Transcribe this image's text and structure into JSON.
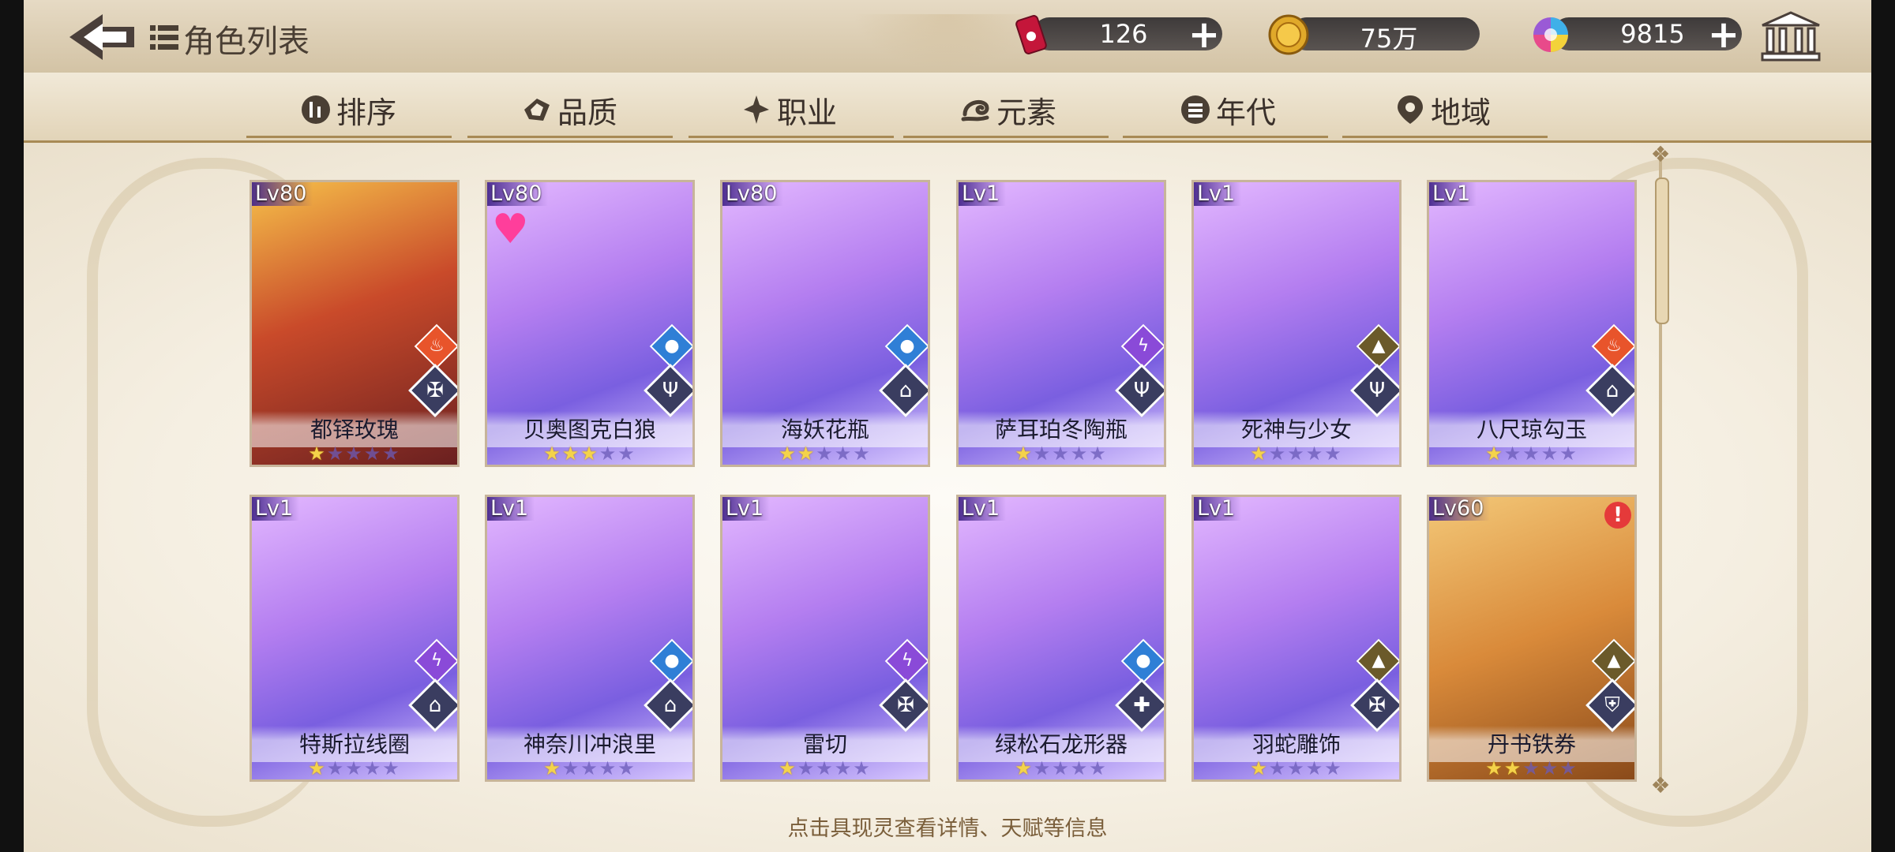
{
  "header": {
    "title": "角色列表",
    "back_icon": "back-arrow-icon",
    "list_icon": "list-icon"
  },
  "resources": [
    {
      "name": "tickets",
      "icon": "ticket-can-icon",
      "value": "126"
    },
    {
      "name": "coins",
      "icon": "gold-coin-icon",
      "value": "75万"
    },
    {
      "name": "gems",
      "icon": "rainbow-gem-icon",
      "value": "9815"
    }
  ],
  "bank_icon": "bank-building-icon",
  "filters": [
    {
      "label": "排序",
      "icon": "sort-icon"
    },
    {
      "label": "品质",
      "icon": "quality-icon"
    },
    {
      "label": "职业",
      "icon": "class-icon"
    },
    {
      "label": "元素",
      "icon": "element-icon"
    },
    {
      "label": "年代",
      "icon": "era-icon"
    },
    {
      "label": "地域",
      "icon": "location-pin-icon"
    }
  ],
  "cards": [
    {
      "level": "Lv80",
      "name": "都铎玫瑰",
      "stars": 1,
      "element": "fire",
      "class": "sword-wing",
      "frame": "gold-red",
      "heart": false,
      "alert": false
    },
    {
      "level": "Lv80",
      "name": "贝奥图克白狼",
      "stars": 3,
      "element": "water",
      "class": "trident",
      "frame": "purple",
      "heart": true,
      "alert": false
    },
    {
      "level": "Lv80",
      "name": "海妖花瓶",
      "stars": 2,
      "element": "water",
      "class": "tome",
      "frame": "purple",
      "heart": false,
      "alert": false
    },
    {
      "level": "Lv1",
      "name": "萨耳珀冬陶瓶",
      "stars": 1,
      "element": "lightning",
      "class": "trident",
      "frame": "purple",
      "heart": false,
      "alert": false
    },
    {
      "level": "Lv1",
      "name": "死神与少女",
      "stars": 1,
      "element": "earth",
      "class": "trident",
      "frame": "purple",
      "heart": false,
      "alert": false
    },
    {
      "level": "Lv1",
      "name": "八尺琼勾玉",
      "stars": 1,
      "element": "fire",
      "class": "tome",
      "frame": "purple",
      "heart": false,
      "alert": false
    },
    {
      "level": "Lv1",
      "name": "特斯拉线圈",
      "stars": 1,
      "element": "lightning",
      "class": "tome",
      "frame": "purple",
      "heart": false,
      "alert": false
    },
    {
      "level": "Lv1",
      "name": "神奈川冲浪里",
      "stars": 1,
      "element": "water",
      "class": "tome",
      "frame": "purple",
      "heart": false,
      "alert": false
    },
    {
      "level": "Lv1",
      "name": "雷切",
      "stars": 1,
      "element": "lightning",
      "class": "sword-wing",
      "frame": "purple",
      "heart": false,
      "alert": false
    },
    {
      "level": "Lv1",
      "name": "绿松石龙形器",
      "stars": 1,
      "element": "water",
      "class": "cross",
      "frame": "purple",
      "heart": false,
      "alert": false
    },
    {
      "level": "Lv1",
      "name": "羽蛇雕饰",
      "stars": 1,
      "element": "earth",
      "class": "sword-wing",
      "frame": "purple",
      "heart": false,
      "alert": false
    },
    {
      "level": "Lv60",
      "name": "丹书铁券",
      "stars": 2,
      "element": "earth",
      "class": "shield",
      "frame": "orange",
      "heart": false,
      "alert": true
    }
  ],
  "element_colors": {
    "fire": "#e8542b",
    "water": "#2f7fd6",
    "lightning": "#8a4ad8",
    "earth": "#6b5a2a"
  },
  "hint": "点击具现灵查看详情、天赋等信息"
}
